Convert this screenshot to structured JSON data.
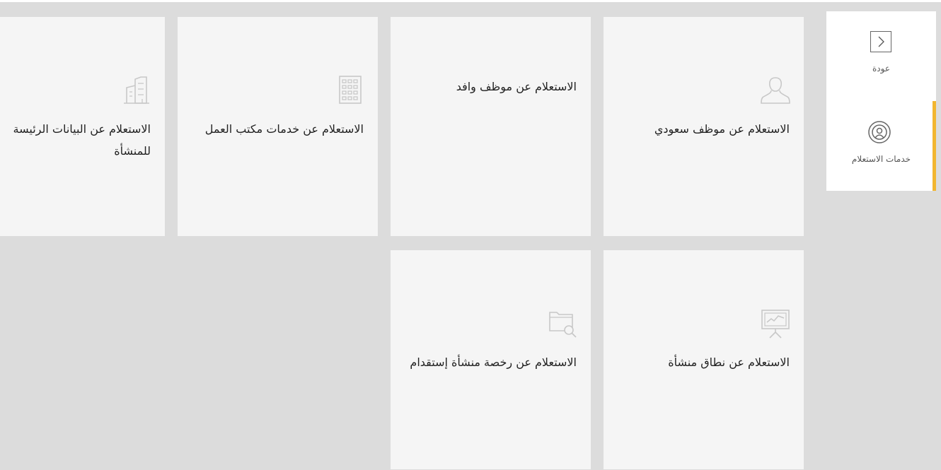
{
  "sidebar": {
    "back_label": "عودة",
    "services_label": "خدمات الاستعلام",
    "accent_color": "#f2b630"
  },
  "cards": [
    {
      "label": "الاستعلام عن موظف سعودي",
      "icon": "person-icon"
    },
    {
      "label": "الاستعلام عن موظف وافد",
      "icon": ""
    },
    {
      "label": "الاستعلام عن خدمات مكتب العمل",
      "icon": "building-icon"
    },
    {
      "label_line1": "الاستعلام عن البيانات الرئيسة",
      "label_line2": "للمنشأة",
      "icon": "office-buildings-icon"
    },
    {
      "label": "الاستعلام عن نطاق منشأة",
      "icon": "presentation-chart-icon"
    },
    {
      "label": "الاستعلام عن رخصة منشأة إستقدام",
      "icon": "folder-search-icon"
    }
  ]
}
